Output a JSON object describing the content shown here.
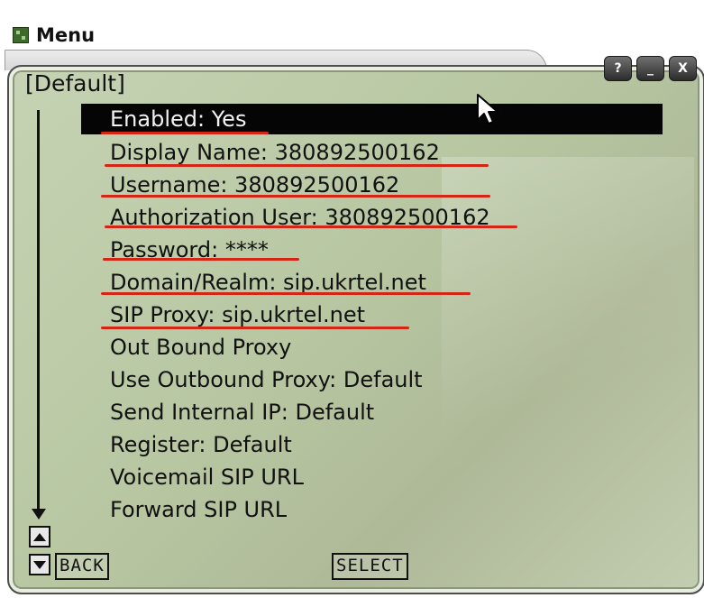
{
  "window": {
    "title": "Menu",
    "buttons": {
      "help": "?",
      "minimize": "_",
      "close": "X"
    }
  },
  "menu": {
    "section": "[Default]",
    "items": [
      "Enabled: Yes",
      "Display Name: 380892500162",
      "Username: 380892500162",
      "Authorization User: 380892500162",
      "Password: ****",
      "Domain/Realm: sip.ukrtel.net",
      "SIP Proxy: sip.ukrtel.net",
      "Out Bound Proxy",
      "Use Outbound Proxy: Default",
      "Send Internal IP: Default",
      "Register: Default",
      "Voicemail SIP URL",
      "Forward SIP URL"
    ],
    "selected_index": 0
  },
  "softkeys": {
    "back": "BACK",
    "select": "SELECT"
  },
  "colors": {
    "panel_bg": "#b8c7a2",
    "selection_bg": "#050505",
    "annotation_underline": "#d52515"
  },
  "icons": [
    "app-icon",
    "help-icon",
    "minimize-icon",
    "close-icon",
    "scroll-up-icon",
    "scroll-down-icon",
    "mouse-pointer-icon"
  ]
}
